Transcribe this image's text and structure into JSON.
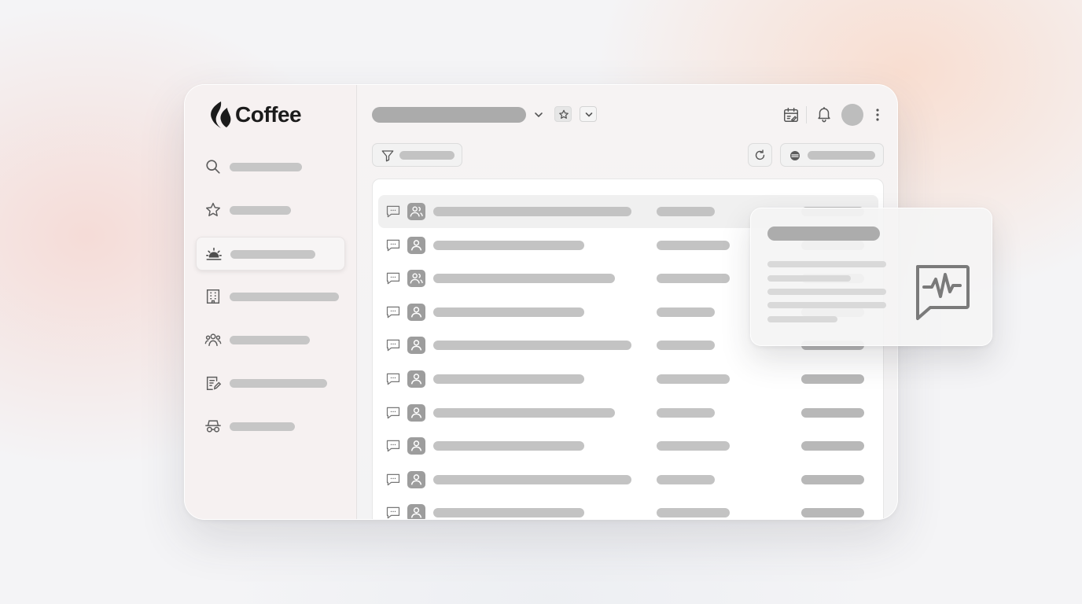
{
  "app": {
    "name": "Coffee"
  },
  "icons": {
    "logo": "coffee-flame-logo",
    "nav": [
      "search-icon",
      "star-icon",
      "sunrise-icon",
      "building-icon",
      "team-icon",
      "edit-note-icon",
      "incognito-icon"
    ],
    "header": [
      "calendar-icon",
      "bell-icon",
      "more-vertical-icon"
    ],
    "popover": "chat-activity-icon"
  },
  "sidebar": {
    "active_index": 2,
    "item_count": 7
  },
  "table": {
    "row_count": 10,
    "highlighted_row": 0
  },
  "colors": {
    "skeleton": "#c3c3c3",
    "skeleton_dark": "#ababab",
    "active_bg": "#f7f5f5",
    "icon": "#6b6b6b"
  }
}
